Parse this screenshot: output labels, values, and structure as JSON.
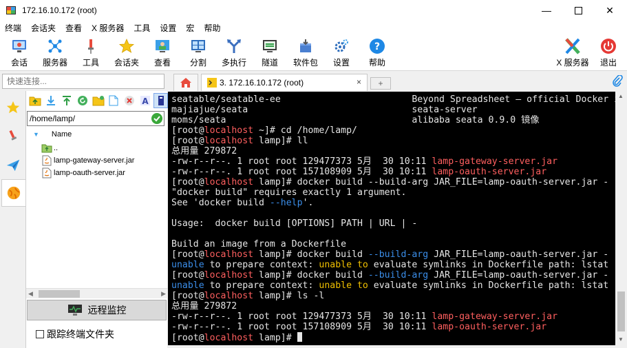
{
  "window": {
    "title": "172.16.10.172 (root)"
  },
  "menu": [
    "终端",
    "会话夹",
    "查看",
    "X 服务器",
    "工具",
    "设置",
    "宏",
    "帮助"
  ],
  "toolbar": {
    "session": "会话",
    "servers": "服务器",
    "tools": "工具",
    "sessions": "会话夹",
    "view": "查看",
    "split": "分割",
    "multiexec": "多执行",
    "tunnel": "隧道",
    "packages": "软件包",
    "settings": "设置",
    "help": "帮助",
    "xserver": "X 服务器",
    "exit": "退出"
  },
  "quick_connect": {
    "placeholder": "快速连接..."
  },
  "tabs": {
    "session_label": "3. 172.16.10.172 (root)",
    "close": "×",
    "new": "+"
  },
  "file_browser": {
    "path": "/home/lamp/",
    "column_name": "Name",
    "entries": [
      "..",
      "lamp-gateway-server.jar",
      "lamp-oauth-server.jar"
    ],
    "remote_monitor": "远程监控",
    "follow_terminal": "跟踪终端文件夹"
  },
  "terminal": {
    "lines": [
      [
        [
          "seatable/seatable-ee                        Beyond Spreadsheet – official Docker ima",
          ""
        ]
      ],
      [
        [
          "majiajue/seata                              seata-server",
          ""
        ]
      ],
      [
        [
          "moms/seata                                  alibaba seata 0.9.0 镜像",
          ""
        ]
      ],
      [
        [
          "[root@",
          ""
        ],
        [
          "localhost",
          "red"
        ],
        [
          " ~]# cd /home/lamp/",
          ""
        ]
      ],
      [
        [
          "[root@",
          ""
        ],
        [
          "localhost",
          "red"
        ],
        [
          " lamp]# ll",
          ""
        ]
      ],
      [
        [
          "总用量 279872",
          ""
        ]
      ],
      [
        [
          "-rw-r--r--. 1 root root 129477373 5月  30 10:11 ",
          ""
        ],
        [
          "lamp-gateway-server.jar",
          "red"
        ]
      ],
      [
        [
          "-rw-r--r--. 1 root root 157108909 5月  30 10:11 ",
          ""
        ],
        [
          "lamp-oauth-server.jar",
          "red"
        ]
      ],
      [
        [
          "[root@",
          ""
        ],
        [
          "localhost",
          "red"
        ],
        [
          " lamp]# docker build --build-arg JAR_FILE=lamp-oauth-server.jar -",
          ""
        ]
      ],
      [
        [
          "\"docker build\" requires exactly 1 argument.",
          ""
        ]
      ],
      [
        [
          "See 'docker build ",
          ""
        ],
        [
          "--help",
          "blue"
        ],
        [
          "'.",
          ""
        ]
      ],
      [
        [
          "",
          ""
        ]
      ],
      [
        [
          "Usage:  docker build [OPTIONS] PATH | URL | -",
          ""
        ]
      ],
      [
        [
          "",
          ""
        ]
      ],
      [
        [
          "Build an image from a Dockerfile",
          ""
        ]
      ],
      [
        [
          "[root@",
          ""
        ],
        [
          "localhost",
          "red"
        ],
        [
          " lamp]# docker build ",
          ""
        ],
        [
          "--build-arg",
          "blue"
        ],
        [
          " JAR_FILE=lamp-oauth-server.jar -",
          ""
        ]
      ],
      [
        [
          "unable",
          "blue"
        ],
        [
          " to prepare context: ",
          ""
        ],
        [
          "unable to",
          "yellow"
        ],
        [
          " evaluate symlinks in Dockerfile path: lstat",
          ""
        ]
      ],
      [
        [
          "[root@",
          ""
        ],
        [
          "localhost",
          "red"
        ],
        [
          " lamp]# docker build ",
          ""
        ],
        [
          "--build-arg",
          "blue"
        ],
        [
          " JAR_FILE=lamp-oauth-server.jar -",
          ""
        ]
      ],
      [
        [
          "unable",
          "blue"
        ],
        [
          " to prepare context: ",
          ""
        ],
        [
          "unable to",
          "yellow"
        ],
        [
          " evaluate symlinks in Dockerfile path: lstat",
          ""
        ]
      ],
      [
        [
          "[root@",
          ""
        ],
        [
          "localhost",
          "red"
        ],
        [
          " lamp]# ls -l",
          ""
        ]
      ],
      [
        [
          "总用量 279872",
          ""
        ]
      ],
      [
        [
          "-rw-r--r--. 1 root root 129477373 5月  30 10:11 ",
          ""
        ],
        [
          "lamp-gateway-server.jar",
          "red"
        ]
      ],
      [
        [
          "-rw-r--r--. 1 root root 157108909 5月  30 10:11 ",
          ""
        ],
        [
          "lamp-oauth-server.jar",
          "red"
        ]
      ],
      [
        [
          "[root@",
          ""
        ],
        [
          "localhost",
          "red"
        ],
        [
          " lamp]# ",
          ""
        ]
      ]
    ]
  },
  "colors": {
    "terminal_bg": "#000000",
    "hostname": "#ff5f5f",
    "option": "#3b8eea",
    "warning": "#f0c000",
    "accent": "#0078d7"
  },
  "icons": {
    "app": "terminal-app-icon",
    "minimize": "minimize-icon",
    "maximize": "maximize-icon",
    "close": "close-icon",
    "home": "home-icon",
    "attach": "paperclip-icon"
  }
}
